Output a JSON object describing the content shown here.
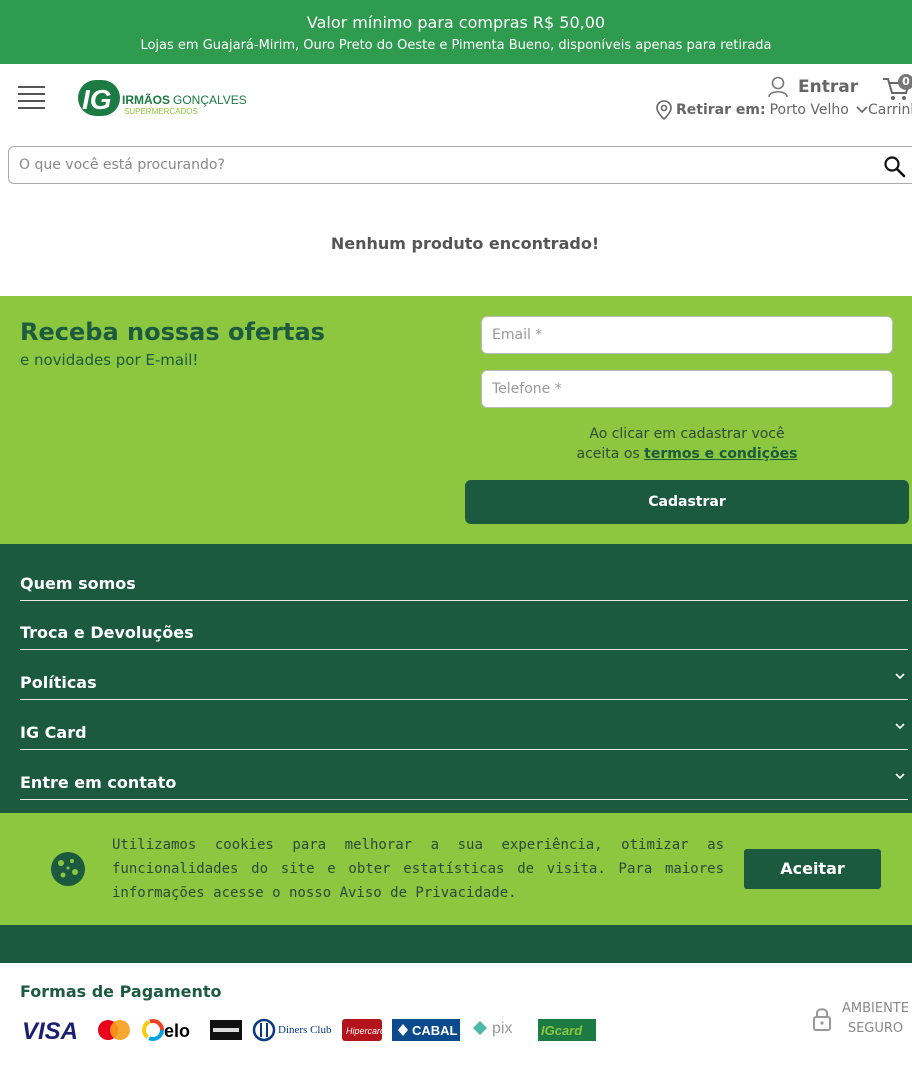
{
  "top_banner": {
    "line1": "Valor mínimo para compras R$ 50,00",
    "line2": "Lojas em Guajará-Mirim, Ouro Preto do Oeste e Pimenta Bueno, disponíveis apenas para retirada"
  },
  "header": {
    "logo_mark": "IG",
    "logo_name_bold": "IRMÃOS",
    "logo_name_light": "GONÇALVES",
    "logo_sub": "SUPERMERCADOS",
    "login_label": "Entrar",
    "cart_count": "0",
    "cart_label": "Carrinho",
    "pickup_label": "Retirar em:",
    "pickup_city": "Porto Velho"
  },
  "search": {
    "placeholder": "O que você está procurando?"
  },
  "results": {
    "empty_message": "Nenhum produto encontrado!"
  },
  "newsletter": {
    "title": "Receba nossas ofertas",
    "subtitle": "e novidades por E-mail!",
    "email_placeholder": "Email *",
    "phone_placeholder": "Telefone *",
    "terms_line1": "Ao clicar em cadastrar você",
    "terms_prefix": "aceita os ",
    "terms_link": "termos e condições",
    "submit_label": "Cadastrar"
  },
  "footer": {
    "items": [
      {
        "label": "Quem somos"
      },
      {
        "label": "Troca e Devoluções"
      },
      {
        "label": "Políticas"
      },
      {
        "label": "IG Card"
      },
      {
        "label": "Entre em contato"
      }
    ]
  },
  "cookie": {
    "text": "Utilizamos cookies para melhorar a sua experiência, otimizar as funcionalidades do site e obter estatísticas de visita. Para maiores informações acesse o nosso Aviso de Privacidade.",
    "accept_label": "Aceitar"
  },
  "payments": {
    "title": "Formas de Pagamento",
    "logos": [
      "VISA",
      "Mastercard",
      "elo",
      "American Express",
      "Diners Club International",
      "Hipercard",
      "CABAL",
      "pix",
      "IGcard"
    ],
    "secure_line1": "AMBIENTE",
    "secure_line2": "SEGURO"
  },
  "colors": {
    "banner_green": "#2e9b4f",
    "dark_green": "#1b5a3f",
    "light_green": "#8dc63f"
  }
}
